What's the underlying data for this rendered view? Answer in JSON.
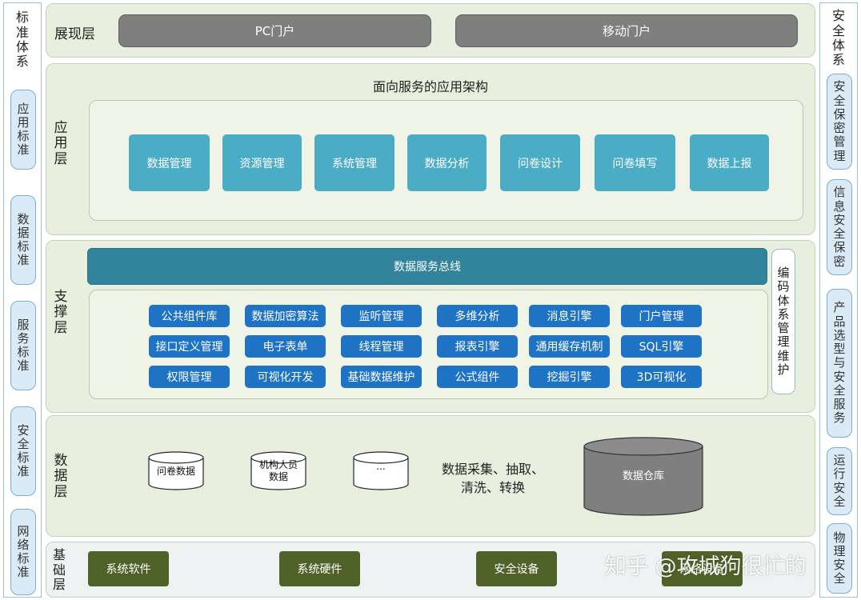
{
  "left_panel": {
    "title": "标准体系",
    "items": [
      "应用标准",
      "数据标准",
      "服务标准",
      "安全标准",
      "网络标准"
    ]
  },
  "right_panel": {
    "title": "安全体系",
    "items": [
      "安全保密管理",
      "信息安全保密",
      "产品选型与安全服务",
      "运行安全",
      "物理安全"
    ]
  },
  "presentation_layer": {
    "label": "展现层",
    "portals": [
      "PC门户",
      "移动门户"
    ]
  },
  "application_layer": {
    "label": "应用层",
    "title": "面向服务的应用架构",
    "modules": [
      "数据管理",
      "资源管理",
      "系统管理",
      "数据分析",
      "问卷设计",
      "问卷填写",
      "数据上报"
    ]
  },
  "support_layer": {
    "label": "支撑层",
    "bus": "数据服务总线",
    "side_box": "编码体系管理维护",
    "components": [
      [
        "公共组件库",
        "数据加密算法",
        "监听管理",
        "多维分析",
        "消息引擎",
        "门户管理"
      ],
      [
        "接口定义管理",
        "电子表单",
        "线程管理",
        "报表引擎",
        "通用缓存机制",
        "SQL引擎"
      ],
      [
        "权限管理",
        "可视化开发",
        "基础数据维护",
        "公式组件",
        "挖掘引擎",
        "3D可视化"
      ]
    ]
  },
  "data_layer": {
    "label": "数据层",
    "stores": [
      "问卷数据",
      "机构人员数据",
      "..."
    ],
    "process_text": "数据采集、抽取、清洗、转换",
    "warehouse": "数据仓库"
  },
  "base_layer": {
    "label": "基础层",
    "items": [
      "系统软件",
      "系统硬件",
      "安全设备",
      "网络设备"
    ]
  },
  "watermark": "知乎 @攻城狗很忙的"
}
